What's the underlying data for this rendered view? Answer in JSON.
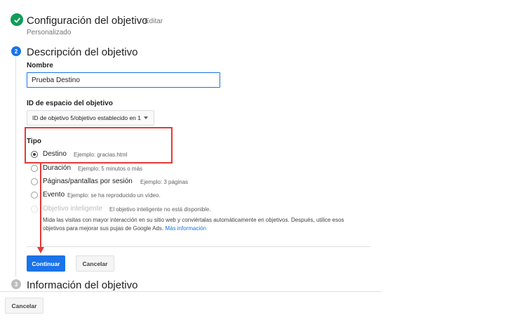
{
  "step1": {
    "title": "Configuración del objetivo",
    "edit_label": "Editar",
    "subtitle": "Personalizado"
  },
  "step2": {
    "number": "2",
    "title": "Descripción del objetivo",
    "name_label": "Nombre",
    "name_value": "Prueba Destino",
    "slot_label": "ID de espacio del objetivo",
    "slot_value": "ID de objetivo 5/objetivo establecido en 1",
    "type_label": "Tipo",
    "options": [
      {
        "label": "Destino",
        "example": "Ejemplo: gracias.html",
        "selected": true
      },
      {
        "label": "Duración",
        "example": "Ejemplo: 5 minutos o más"
      },
      {
        "label": "Páginas/pantallas por sesión",
        "example": "Ejemplo: 3 páginas"
      },
      {
        "label": "Evento",
        "example": "Ejemplo: se ha reproducido un vídeo."
      },
      {
        "label": "Objetivo inteligente",
        "example": "El objetivo inteligente no está disponible.",
        "disabled": true
      }
    ],
    "help_line1": "Mida las visitas con mayor interacción en su sitio web y conviértalas automáticamente en objetivos. Después, utilice esos",
    "help_line2": "objetivos para mejorar sus pujas de Google Ads.",
    "help_link": "Más información",
    "continue_label": "Continuar",
    "cancel_label": "Cancelar"
  },
  "step3": {
    "number": "3",
    "title": "Información del objetivo"
  },
  "footer": {
    "cancel_label": "Cancelar"
  },
  "colors": {
    "accent": "#1a73e8",
    "success": "#0f9d58",
    "highlight": "#e53935"
  }
}
